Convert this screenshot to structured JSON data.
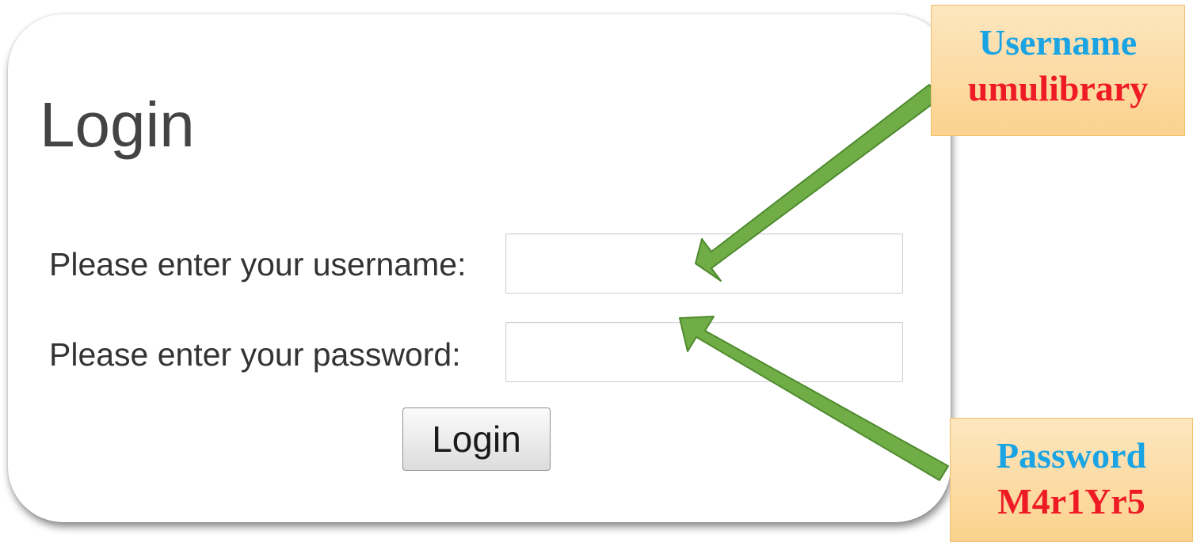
{
  "login_form": {
    "title": "Login",
    "username_label": "Please enter your username:",
    "username_value": "",
    "password_label": "Please enter your password:",
    "password_value": "",
    "submit_label": "Login"
  },
  "annotations": {
    "username": {
      "label": "Username",
      "value": "umulibrary"
    },
    "password": {
      "label": "Password",
      "value": "M4r1Yr5"
    },
    "colors": {
      "callout_label": "#1ba4e3",
      "callout_value": "#ee1b24",
      "callout_background": "#fbd28e",
      "arrow": "#70ad47"
    }
  }
}
